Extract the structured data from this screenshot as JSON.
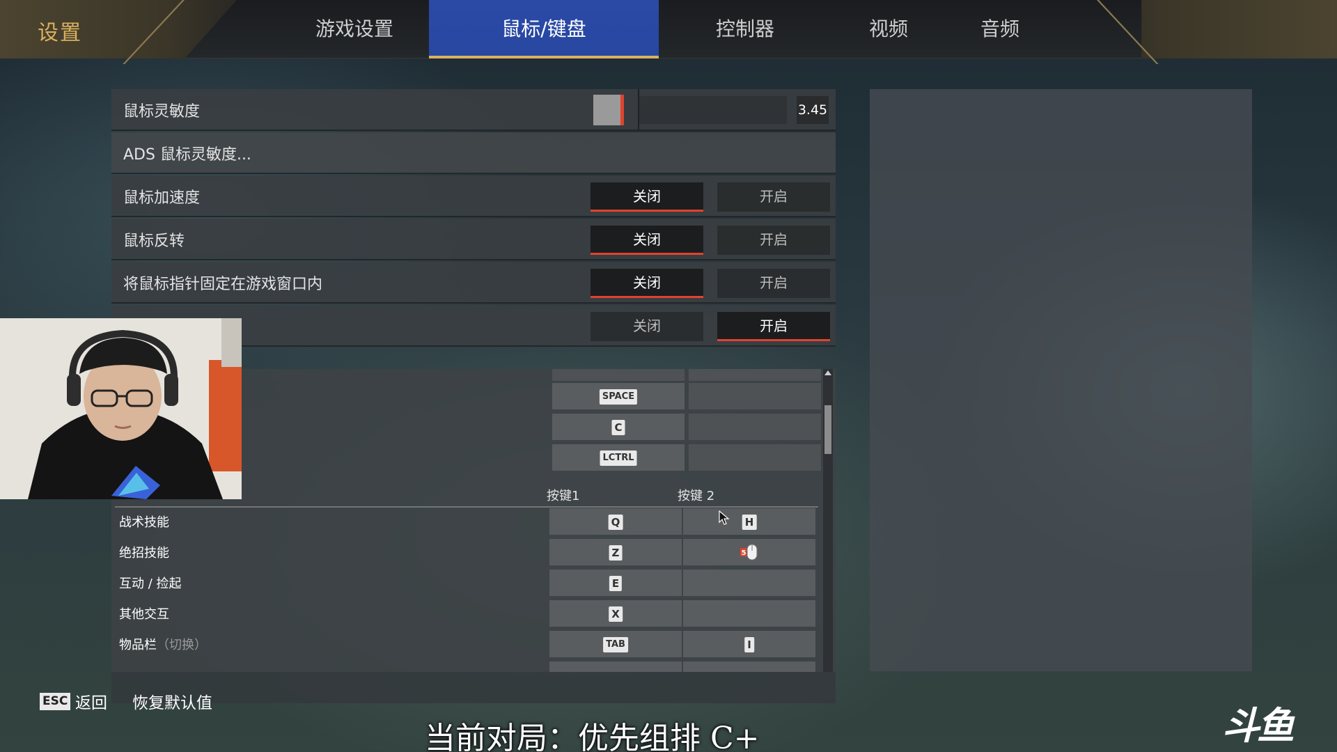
{
  "header": {
    "title": "设置",
    "tabs": [
      {
        "label": "游戏设置"
      },
      {
        "label": "鼠标/键盘"
      },
      {
        "label": "控制器"
      },
      {
        "label": "视频"
      },
      {
        "label": "音频"
      }
    ],
    "active_tab": "鼠标/键盘"
  },
  "settings": {
    "sensitivity": {
      "label": "鼠标灵敏度",
      "value": "3.45"
    },
    "ads": {
      "label": "ADS 鼠标灵敏度..."
    },
    "rows": [
      {
        "label": "鼠标加速度",
        "off": "关闭",
        "on": "开启",
        "selected": "off"
      },
      {
        "label": "鼠标反转",
        "off": "关闭",
        "on": "开启",
        "selected": "off"
      },
      {
        "label": "将鼠标指针固定在游戏窗口内",
        "off": "关闭",
        "on": "开启",
        "selected": "off"
      },
      {
        "label": "",
        "off": "关闭",
        "on": "开启",
        "selected": "on"
      }
    ]
  },
  "keybinds": {
    "header_key1": "按键1",
    "header_key2": "按键 2",
    "upper_keys": [
      "SPACE",
      "C",
      "LCTRL"
    ],
    "rows": [
      {
        "label": "战术技能",
        "key1": "Q",
        "key2": "H"
      },
      {
        "label": "绝招技能",
        "key1": "Z",
        "key2": "mouse-5"
      },
      {
        "label": "互动 / 捡起",
        "key1": "E",
        "key2": ""
      },
      {
        "label": "其他交互",
        "key1": "X",
        "key2": ""
      },
      {
        "label": "物品栏",
        "label_sub": "（切换）",
        "key1": "TAB",
        "key2": "I"
      }
    ]
  },
  "footer": {
    "esc_key": "ESC",
    "back_label": "返回",
    "reset_label": "恢复默认值"
  },
  "overlay": {
    "caption": "当前对局：优先组排 C+",
    "watermark": "斗鱼"
  },
  "colors": {
    "accent_red": "#e0432e",
    "tab_active": "#2747a1",
    "gold": "#d9b15f"
  }
}
